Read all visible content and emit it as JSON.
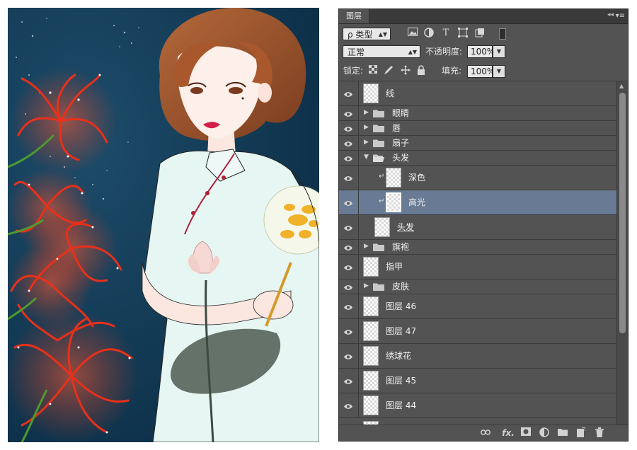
{
  "panel": {
    "tab_title": "图层",
    "filter": {
      "label": "ρ 类型",
      "icons": [
        "image-filter-icon",
        "adjustment-filter-icon",
        "text-filter-icon",
        "shape-filter-icon",
        "smart-object-filter-icon"
      ],
      "text_icon": "T"
    },
    "blend": {
      "mode": "正常",
      "opacity_label": "不透明度:",
      "opacity_value": "100%"
    },
    "lock": {
      "label": "锁定:",
      "fill_label": "填充:",
      "fill_value": "100%"
    },
    "layers": [
      {
        "name": "线",
        "type": "layer"
      },
      {
        "name": "眼睛",
        "type": "group"
      },
      {
        "name": "唇",
        "type": "group"
      },
      {
        "name": "扇子",
        "type": "group"
      },
      {
        "name": "头发",
        "type": "group",
        "expanded": true
      },
      {
        "name": "深色",
        "type": "layer",
        "clipped": true,
        "indent": true
      },
      {
        "name": "高光",
        "type": "layer",
        "clipped": true,
        "indent": true,
        "selected": true
      },
      {
        "name": "头发",
        "type": "layer",
        "indent": true,
        "underline": true
      },
      {
        "name": "旗袍",
        "type": "group"
      },
      {
        "name": "指甲",
        "type": "layer"
      },
      {
        "name": "皮肤",
        "type": "group"
      },
      {
        "name": "图层 46",
        "type": "layer"
      },
      {
        "name": "图层 47",
        "type": "layer"
      },
      {
        "name": "绣球花",
        "type": "layer"
      },
      {
        "name": "图层 45",
        "type": "layer"
      },
      {
        "name": "图层 44",
        "type": "layer"
      }
    ],
    "footer_icons": [
      "link-layers-icon",
      "fx-icon",
      "layer-mask-icon",
      "adjustment-layer-icon",
      "new-group-icon",
      "new-layer-icon",
      "delete-layer-icon"
    ],
    "fx_label": "fx.",
    "colors": {
      "panel_bg": "#535353",
      "selected_row": "#687a94",
      "art_bg": "#0f3a55"
    }
  }
}
